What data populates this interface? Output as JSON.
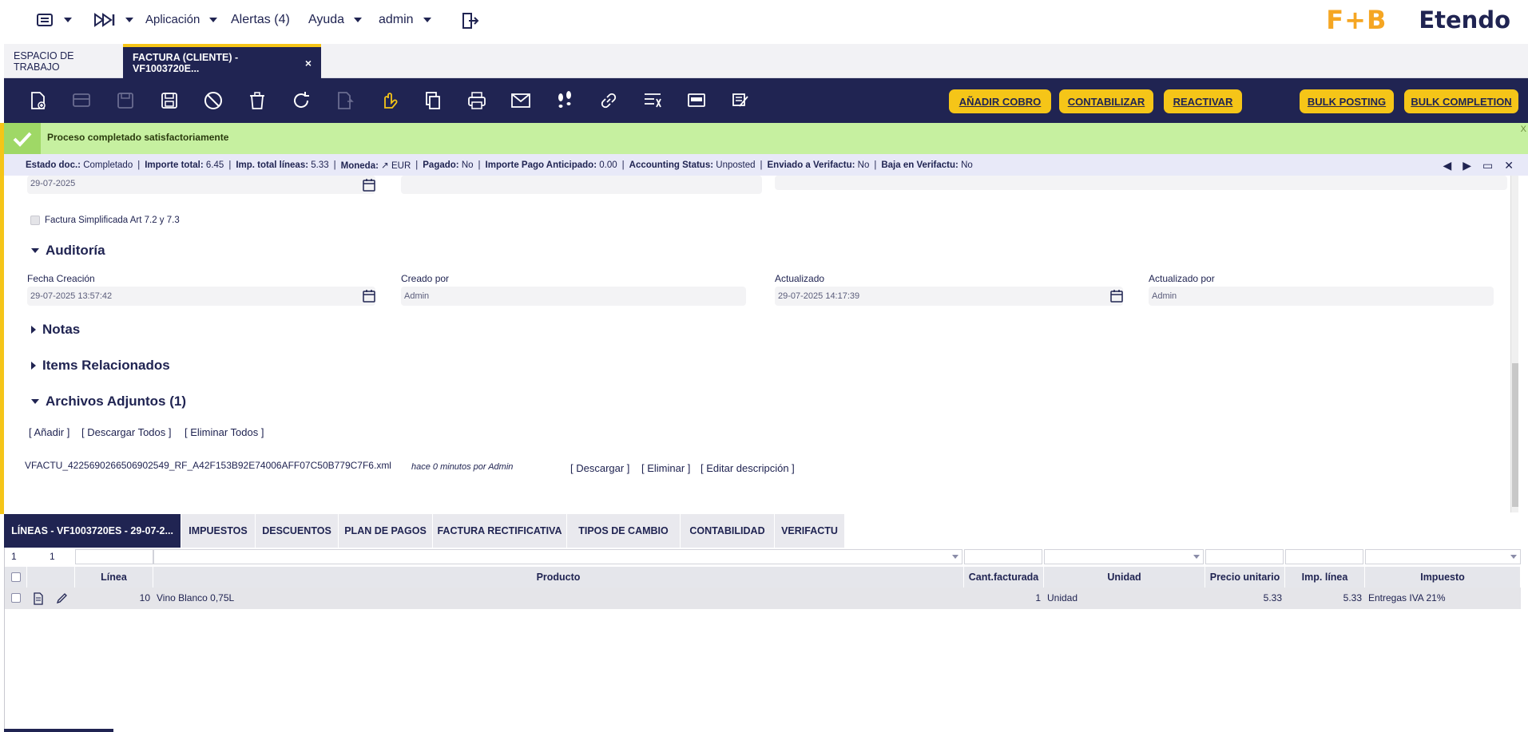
{
  "topnav": {
    "app_menu": "Aplicación",
    "alerts": "Alertas (4)",
    "help": "Ayuda",
    "user": "admin",
    "logo_left": "F+B",
    "logo_right": "Etendo"
  },
  "window_tabs": [
    {
      "label": "ESPACIO DE TRABAJO"
    },
    {
      "label": "FACTURA (CLIENTE) - VF1003720E...",
      "close": "×"
    }
  ],
  "toolbar": {
    "buttons": {
      "add_payment": "AÑADIR COBRO",
      "post": "CONTABILIZAR",
      "reactivate": "REACTIVAR",
      "bulk_posting": "BULK POSTING",
      "bulk_completion": "BULK COMPLETION"
    }
  },
  "message": {
    "text": "Proceso completado satisfactoriamente",
    "close": "X"
  },
  "status": {
    "items": [
      {
        "label": "Estado doc.:",
        "value": "Completado"
      },
      {
        "label": "Importe total:",
        "value": "6.45"
      },
      {
        "label": "Imp. total líneas:",
        "value": "5.33"
      },
      {
        "label": "Moneda:",
        "value": "↗ EUR"
      },
      {
        "label": "Pagado:",
        "value": "No"
      },
      {
        "label": "Importe Pago Anticipado:",
        "value": "0.00"
      },
      {
        "label": "Accounting Status:",
        "value": "Unposted"
      },
      {
        "label": "Enviado a Verifactu:",
        "value": "No"
      },
      {
        "label": "Baja en Verifactu:",
        "value": "No"
      }
    ]
  },
  "form": {
    "top_date": "29-07-2025",
    "simplified_invoice": "Factura Simplificada Art 7.2 y 7.3",
    "audit": {
      "title": "Auditoría",
      "created_label": "Fecha Creación",
      "created_value": "29-07-2025 13:57:42",
      "created_by_label": "Creado por",
      "created_by_value": "Admin",
      "updated_label": "Actualizado",
      "updated_value": "29-07-2025 14:17:39",
      "updated_by_label": "Actualizado por",
      "updated_by_value": "Admin"
    },
    "notes_title": "Notas",
    "related_title": "Items Relacionados",
    "attachments": {
      "title": "Archivos Adjuntos (1)",
      "add": "[ Añadir ]",
      "download_all": "[ Descargar Todos ]",
      "delete_all": "[ Eliminar Todos ]",
      "file_name": "VFACTU_4225690266506902549_RF_A42F153B92E74006AFF07C50B779C7F6.xml",
      "file_meta": "hace 0 minutos por Admin",
      "download": "[ Descargar ]",
      "delete": "[ Eliminar ]",
      "edit_desc": "[ Editar descripción ]"
    }
  },
  "subtabs": [
    "LÍNEAS - VF1003720ES - 29-07-2...",
    "IMPUESTOS",
    "DESCUENTOS",
    "PLAN DE PAGOS",
    "FACTURA RECTIFICATIVA",
    "TIPOS DE CAMBIO",
    "CONTABILIDAD",
    "VERIFACTU"
  ],
  "grid": {
    "filter_counts": [
      "1",
      "1"
    ],
    "columns": [
      "Línea",
      "Producto",
      "Cant.facturada",
      "Unidad",
      "Precio unitario",
      "Imp. línea",
      "Impuesto"
    ],
    "rows": [
      {
        "line": "10",
        "product": "Vino Blanco 0,75L",
        "qty": "1",
        "unit": "Unidad",
        "price": "5.33",
        "amount": "5.33",
        "tax": "Entregas IVA 21%"
      }
    ]
  }
}
